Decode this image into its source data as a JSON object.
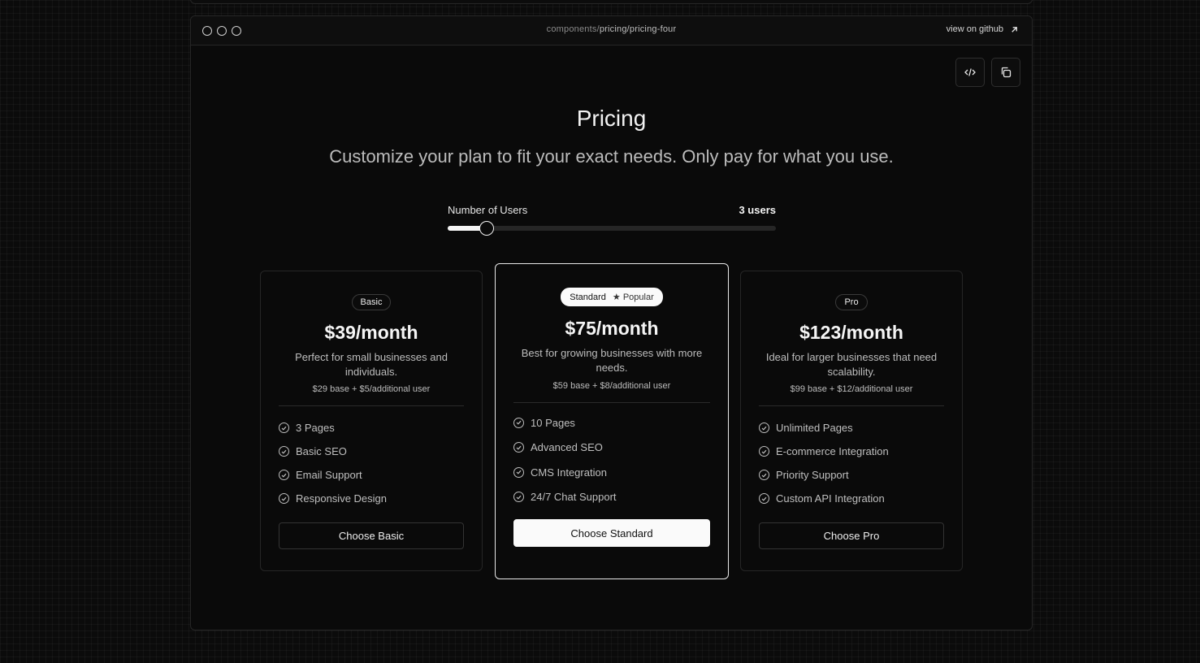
{
  "browser": {
    "url_prefix": "components/",
    "url_path": "pricing/pricing-four",
    "github_label": "view on github"
  },
  "toolbar": {
    "code_icon": "code-icon",
    "copy_icon": "copy-icon"
  },
  "header": {
    "title": "Pricing",
    "subtitle": "Customize your plan to fit your exact needs. Only pay for what you use."
  },
  "slider": {
    "label": "Number of Users",
    "value_label": "3 users",
    "level_fraction": 0.12
  },
  "plans": [
    {
      "badge": "Basic",
      "price": "$39/month",
      "description": "Perfect for small businesses and individuals.",
      "formula": "$29 base + $5/additional user",
      "features": [
        "3 Pages",
        "Basic SEO",
        "Email Support",
        "Responsive Design"
      ],
      "cta": "Choose Basic"
    },
    {
      "badge": "Standard",
      "popular_label": "★ Popular",
      "price": "$75/month",
      "description": "Best for growing businesses with more needs.",
      "formula": "$59 base + $8/additional user",
      "features": [
        "10 Pages",
        "Advanced SEO",
        "CMS Integration",
        "24/7 Chat Support"
      ],
      "cta": "Choose Standard"
    },
    {
      "badge": "Pro",
      "price": "$123/month",
      "description": "Ideal for larger businesses that need scalability.",
      "formula": "$99 base + $12/additional user",
      "features": [
        "Unlimited Pages",
        "E-commerce Integration",
        "Priority Support",
        "Custom API Integration"
      ],
      "cta": "Choose Pro"
    }
  ]
}
